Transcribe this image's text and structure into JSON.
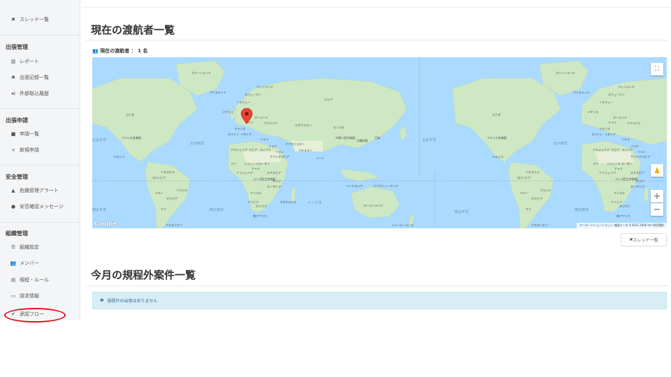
{
  "sidebar": {
    "thread_list": "スレッド一覧",
    "section_trip": "出張管理",
    "report": "レポート",
    "trip_records": "出張記録一覧",
    "external_inbox": "外部取込履歴",
    "section_apply": "出張申請",
    "apply_list": "申請一覧",
    "new_apply": "新規申請",
    "section_safety": "安全管理",
    "risk_alert": "危機管理アラート",
    "safety_message": "安否確認メッセージ",
    "section_org": "組織管理",
    "org_settings": "組織設定",
    "members": "メンバー",
    "rules": "規程・ルール",
    "billing": "請求情報",
    "approval_flow": "承認フロー"
  },
  "main": {
    "title": "現在の渡航者一覧",
    "count_label": "現在の渡航者 ： 1 名",
    "thread_button": "スレッド一覧",
    "section2_title": "今月の規程外案件一覧",
    "alert_text": "規程外の出張はありません"
  },
  "map": {
    "labels": {
      "greenland": "グリーンランド",
      "iceland": "アイスランド",
      "finland": "フィンランド",
      "sweden": "スウェーデン",
      "norway": "ノルウェー",
      "russia": "ロシア",
      "uk": "イギリス",
      "poland": "ポーランド",
      "germany": "ドイツ",
      "ukraine": "ウクライナ",
      "france": "フランス",
      "spain": "スペイン",
      "italy": "イタリア",
      "kazakhstan": "カザフスタン",
      "mongolia": "モンゴル",
      "china": "中華人民共和国",
      "japan": "日本",
      "korea": "大韓民国",
      "canada": "カナダ",
      "usa": "アメリカ合衆国",
      "mexico": "メキシコ",
      "turkey": "トルコ",
      "iraq": "イラク",
      "afghanistan": "アフガニスタン",
      "pakistan": "パキスタン",
      "iran": "イラン",
      "india": "インド",
      "algeria": "アルジェリア",
      "libya": "リビア",
      "egypt": "エジプト",
      "saudi": "サウジアラビア",
      "mali": "マリ",
      "niger": "ニジェール",
      "sudan": "スーダン",
      "chad": "チャド",
      "nigeria": "ナイジェリア",
      "ethiopia": "エチオピア",
      "venezuela": "ベネズエラ",
      "colombia": "コロンビア",
      "peru": "ペルー",
      "brazil": "ブラジル",
      "bolivia": "ボリビア",
      "chile": "チリ",
      "argentina": "アルゼンチン",
      "drc": "コンゴ民主共和国",
      "tanzania": "タンザニア",
      "angola": "アンゴラ",
      "namibia": "ナミビア",
      "botswana": "ボツワナ",
      "madagascar": "マダガスカル",
      "south_africa": "南アフリカ",
      "indonesia": "インドネシア",
      "png": "パプアニューギニア",
      "australia": "オーストラリア",
      "nz": "ニュージーランド",
      "kenya": "ケニア",
      "atlantic": "北大西洋",
      "pacific_n": "北太平洋",
      "indian_ocean": "インド洋",
      "pacific_s": "南太平洋",
      "atlantic_s": "南大西洋"
    },
    "credit": "キーボードショートカット  地図データ ©2021  2000 km  利用規約",
    "google_logo": "Google"
  }
}
